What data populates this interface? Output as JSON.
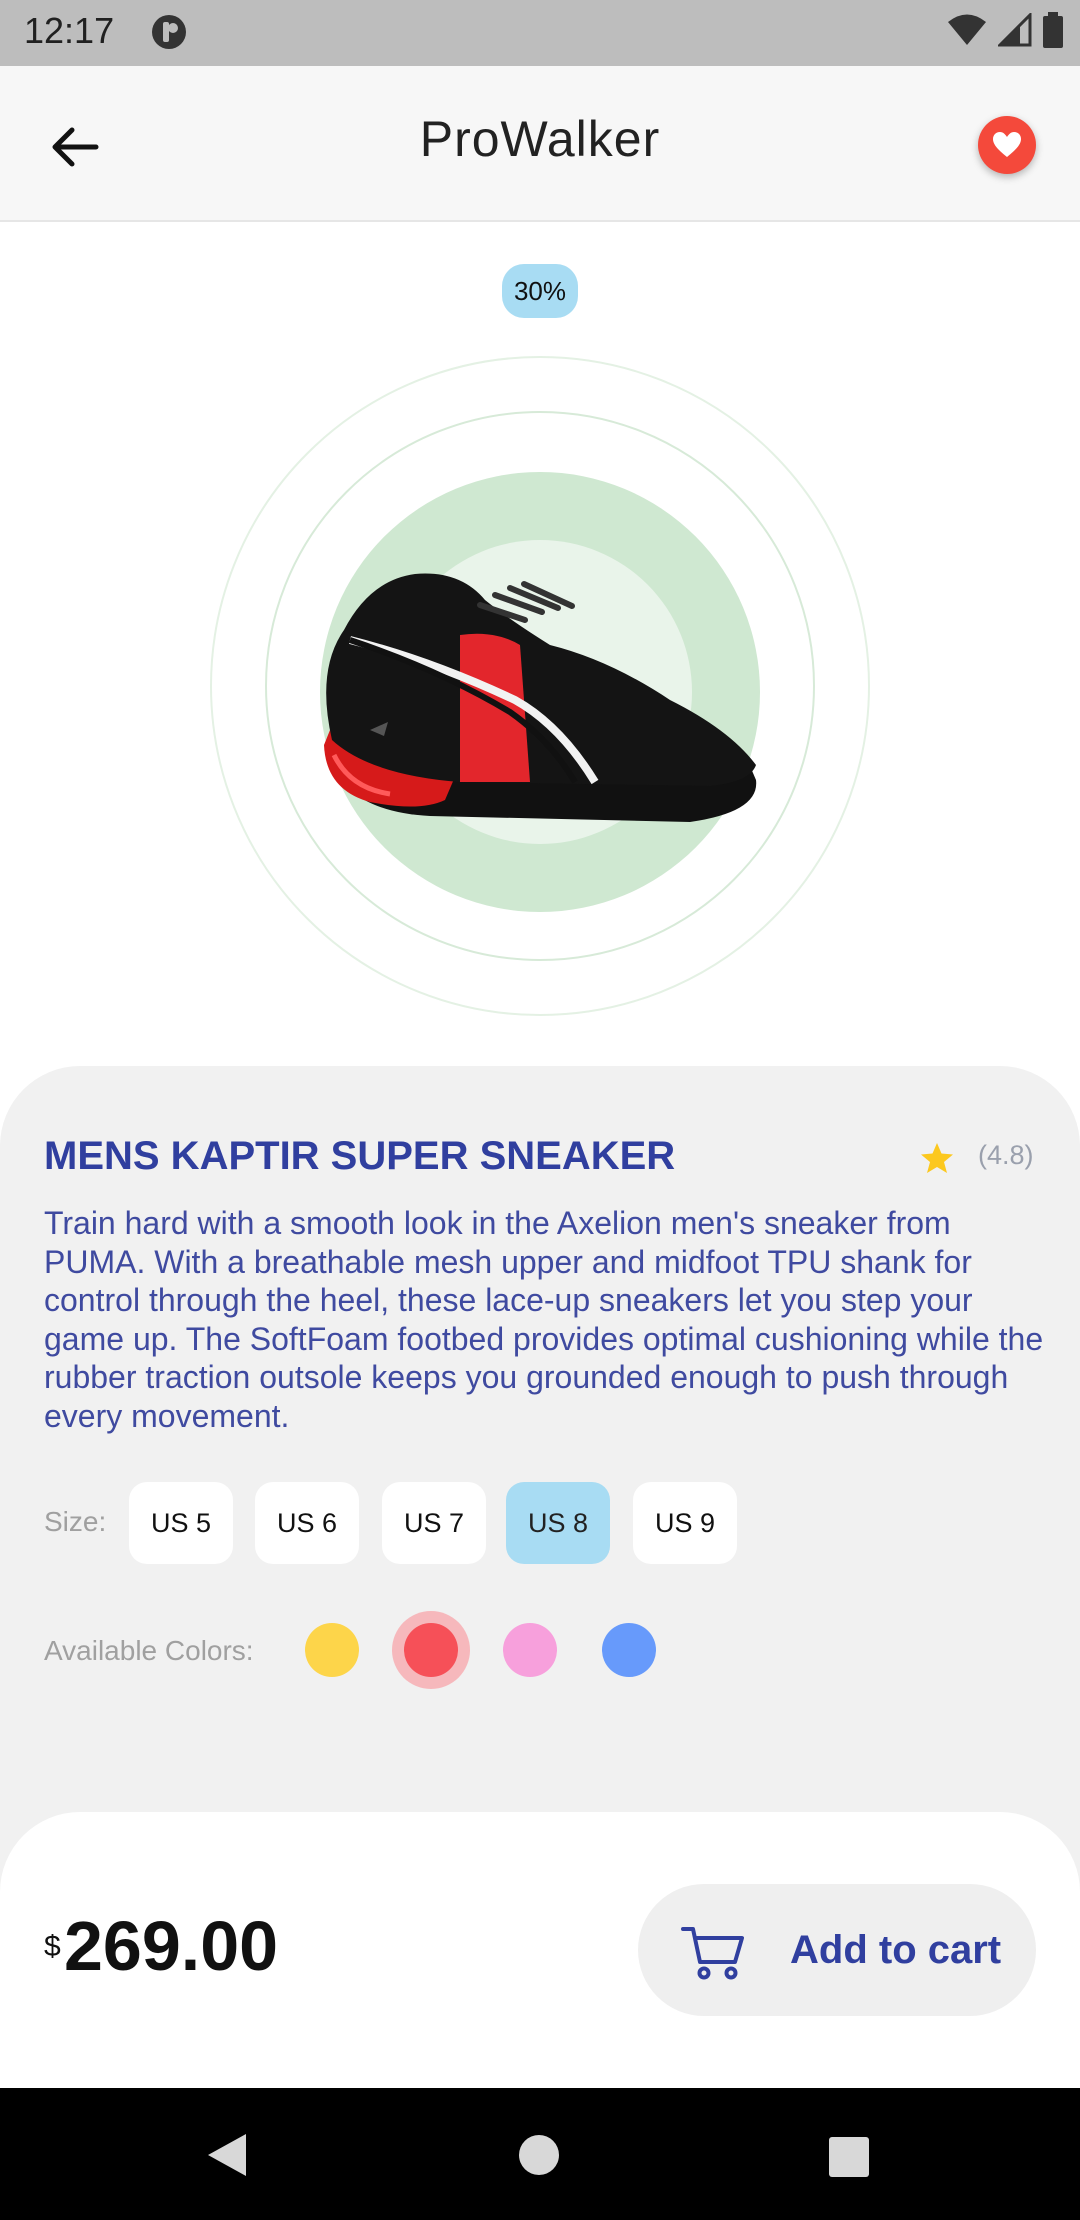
{
  "status_bar": {
    "time": "12:17"
  },
  "header": {
    "title": "ProWalker"
  },
  "badge": {
    "discount": "30%"
  },
  "product": {
    "name": "MENS KAPTIR SUPER SNEAKER",
    "rating": "(4.8)",
    "description": "Train hard with a smooth look in the Axelion men's sneaker from PUMA. With a breathable mesh upper and midfoot TPU shank for control through the heel, these lace-up sneakers let you step your game up. The SoftFoam footbed provides optimal cushioning while the rubber traction outsole keeps you grounded enough to push through every movement."
  },
  "sizes": {
    "label": "Size:",
    "options": [
      "US 5",
      "US 6",
      "US 7",
      "US 8",
      "US 9"
    ],
    "selected": "US 8"
  },
  "colors": {
    "label": "Available Colors:",
    "options": [
      "#fdd54a",
      "#f65058",
      "#f7a0dc",
      "#679afb"
    ],
    "selected": "#f65058"
  },
  "price": {
    "currency": "$",
    "amount": "269.00"
  },
  "cart": {
    "label": "Add to cart"
  },
  "theme": {
    "accent": "#303f9f",
    "favorite": "#f4493b",
    "chip_selected": "#a8dcf3",
    "hero_circle": "#cfe8d1"
  },
  "icons": [
    "back-arrow-icon",
    "heart-icon",
    "star-icon",
    "cart-icon",
    "nav-back-icon",
    "nav-home-icon",
    "nav-recents-icon"
  ]
}
